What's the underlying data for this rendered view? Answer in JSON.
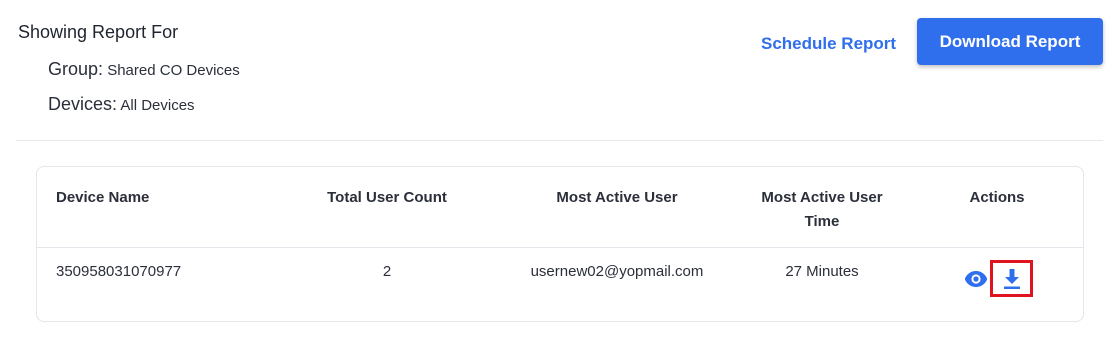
{
  "header": {
    "title": "Showing Report For",
    "group_label": "Group:",
    "group_value": "Shared CO Devices",
    "devices_label": "Devices:",
    "devices_value": "All Devices",
    "schedule_link": "Schedule Report",
    "download_button": "Download Report"
  },
  "table": {
    "columns": [
      "Device Name",
      "Total User Count",
      "Most Active User",
      "Most Active User Time",
      "Actions"
    ],
    "rows": [
      {
        "device_name": "350958031070977",
        "total_user_count": "2",
        "most_active_user": "usernew02@yopmail.com",
        "most_active_user_time": "27 Minutes"
      }
    ]
  },
  "colors": {
    "accent": "#2f6fed",
    "highlight_border": "#e0141e"
  },
  "icons": {
    "view": "eye-icon",
    "download": "download-icon"
  }
}
